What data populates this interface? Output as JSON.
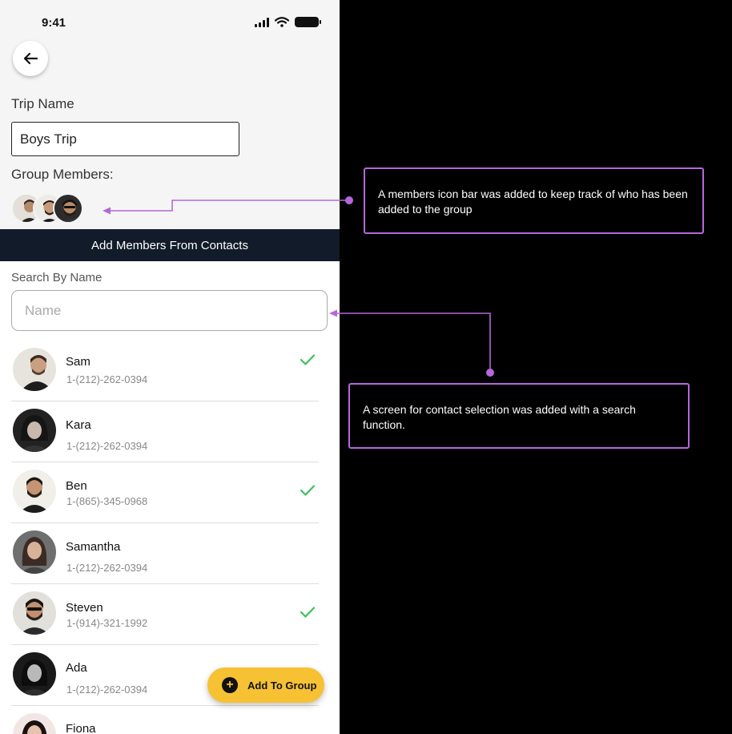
{
  "status_bar": {
    "time": "9:41"
  },
  "form": {
    "trip_name_label": "Trip Name",
    "trip_name_value": "Boys Trip",
    "group_members_label": "Group Members:"
  },
  "contacts_header": "Add Members From Contacts",
  "search": {
    "label": "Search By Name",
    "placeholder": "Name"
  },
  "contacts": [
    {
      "name": "Sam",
      "phone": "1-(212)-262-0394",
      "selected": true
    },
    {
      "name": "Kara",
      "phone": "1-(212)-262-0394",
      "selected": false
    },
    {
      "name": "Ben",
      "phone": "1-(865)-345-0968",
      "selected": true
    },
    {
      "name": "Samantha",
      "phone": "1-(212)-262-0394",
      "selected": false
    },
    {
      "name": "Steven",
      "phone": "1-(914)-321-1992",
      "selected": true
    },
    {
      "name": "Ada",
      "phone": "1-(212)-262-0394",
      "selected": false
    },
    {
      "name": "Fiona",
      "phone": "",
      "selected": false
    }
  ],
  "add_button_label": "Add To Group",
  "annotations": {
    "members_bar_note": "A members icon bar was added to keep track of who has been added to the group",
    "contact_screen_note": "A screen for contact selection was added with a search function."
  },
  "colors": {
    "accent_purple": "#b468dc",
    "check_green": "#3cc15b",
    "button_yellow": "#f6c233",
    "header_navy": "#111b29"
  }
}
